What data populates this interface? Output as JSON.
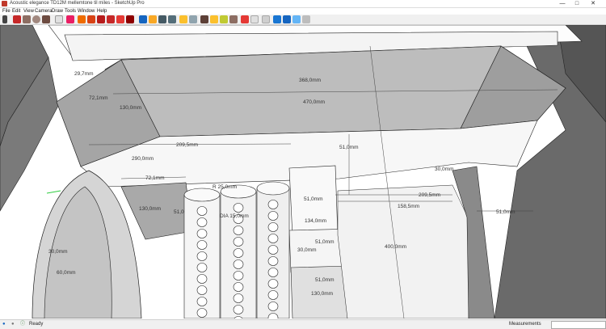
{
  "window": {
    "title": "Acoustic elegance TD12M mellemtone til miles - SketchUp Pro",
    "minimize": "—",
    "maximize": "□",
    "close": "✕"
  },
  "menu": [
    "File",
    "Edit",
    "View",
    "Camera",
    "Draw",
    "Tools",
    "Window",
    "Help"
  ],
  "toolbar_icons": [
    "select-icon",
    "pencil-icon",
    "rectangle-icon",
    "circle-icon",
    "polygon-icon",
    "eraser-icon",
    "paint-icon",
    "pushpull-icon",
    "move-icon",
    "rotate-icon",
    "offset-icon",
    "followme-icon",
    "tape-icon",
    "orbit-icon",
    "pan-icon",
    "zoom-icon",
    "zoom-extents-icon",
    "section-icon",
    "warehouse-icon",
    "components-icon",
    "styles-icon",
    "layers-icon",
    "scenes-icon",
    "shadows-icon",
    "iso-view-icon",
    "top-view-icon",
    "front-view-icon",
    "right-view-icon",
    "xray-icon",
    "wireframe-icon"
  ],
  "dimensions": {
    "d1": "29,7mm",
    "d2": "72,1mm",
    "d3": "130,0mm",
    "d4": "368,0mm",
    "d5": "470,0mm",
    "d6": "209,5mm",
    "d7": "290,0mm",
    "d8": "51,0mm",
    "d9": "30,0mm",
    "d10": "72,1mm",
    "d11": "130,0mm",
    "d12": "51,0",
    "d13": "R 25,0mm",
    "d14": "DIA 15,0mm",
    "d15": "51,0mm",
    "d16": "209,5mm",
    "d17": "158,5mm",
    "d18": "51,0mm",
    "d19": "134,0mm",
    "d20": "51,0mm",
    "d21": "400,0mm",
    "d22": "30,0mm",
    "d23": "51,0mm",
    "d24": "130,0mm",
    "d25": "30,0mm",
    "d26": "60,0mm"
  },
  "status": {
    "text": "Ready",
    "measurements_label": "Measurements",
    "measurements_value": ""
  }
}
